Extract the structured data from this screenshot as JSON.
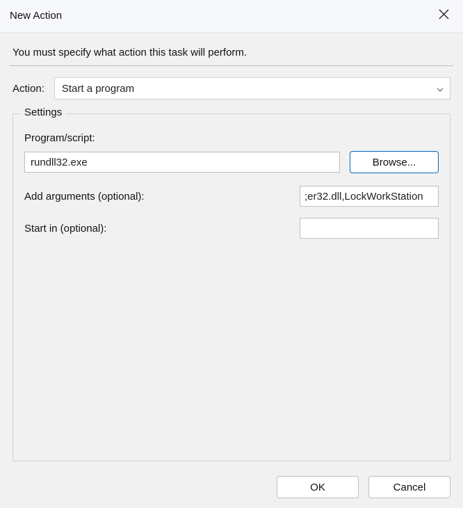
{
  "window": {
    "title": "New Action"
  },
  "instruction": "You must specify what action this task will perform.",
  "action": {
    "label": "Action:",
    "selected": "Start a program"
  },
  "settings": {
    "legend": "Settings",
    "program": {
      "label": "Program/script:",
      "value": "rundll32.exe",
      "browse_label": "Browse..."
    },
    "arguments": {
      "label": "Add arguments (optional):",
      "value": ";er32.dll,LockWorkStation"
    },
    "startin": {
      "label": "Start in (optional):",
      "value": ""
    }
  },
  "footer": {
    "ok_label": "OK",
    "cancel_label": "Cancel"
  }
}
